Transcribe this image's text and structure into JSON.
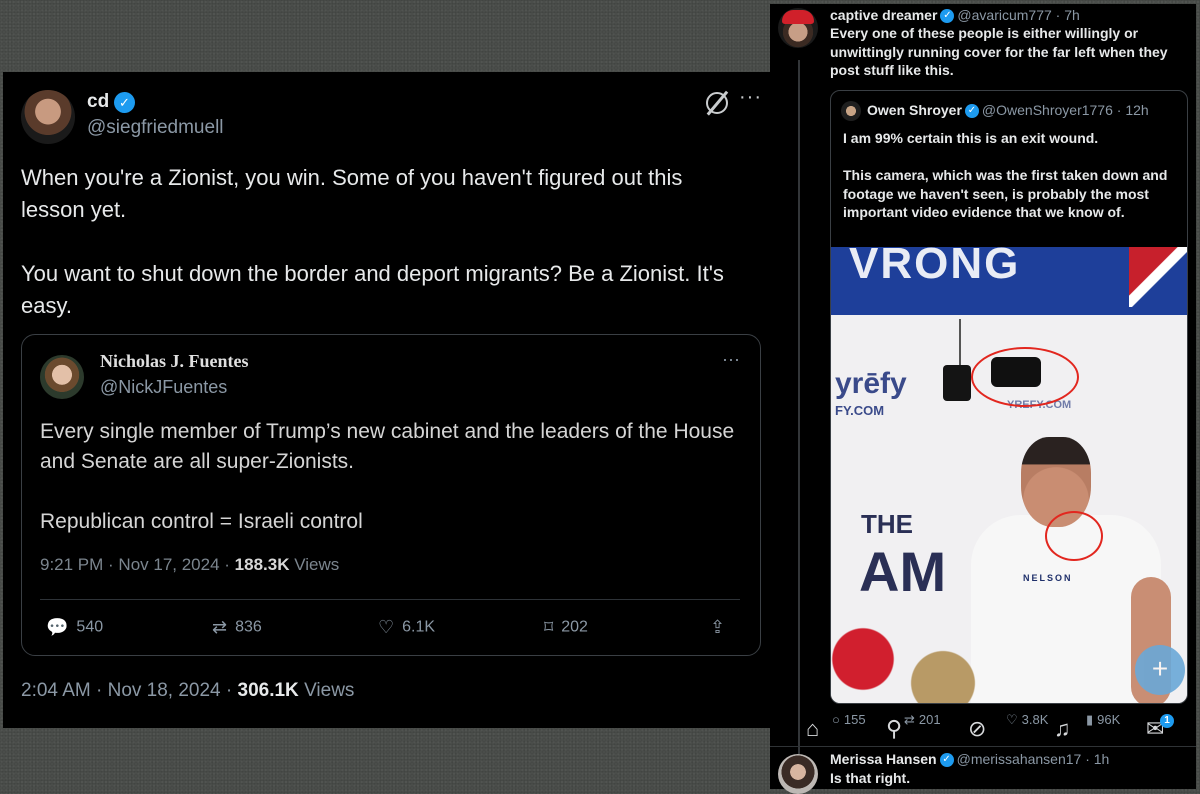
{
  "left_post": {
    "author_name": "cd",
    "author_handle": "@siegfriedmuell",
    "more": "···",
    "text": "When you're a Zionist, you win.  Some of you haven't figured out this lesson yet.\n\nYou want to shut down the border and deport migrants?  Be a Zionist.  It's easy.",
    "time": "2:04 AM · Nov 18, 2024 · ",
    "views_count": "306.1K",
    "views_label": " Views",
    "quote": {
      "author_name": "Nicholas J. Fuentes",
      "author_handle": "@NickJFuentes",
      "more": "···",
      "text": "Every single member of Trump’s new cabinet and the leaders of the House and Senate are all super-Zionists.\n\nRepublican control = Israeli control",
      "time": "9:21 PM · Nov 17, 2024 · ",
      "views_count": "188.3K",
      "views_label": " Views",
      "replies": "540",
      "reposts": "836",
      "likes": "6.1K",
      "bookmarks": "202"
    }
  },
  "right_thread": {
    "reply1": {
      "author_name": "captive dreamer",
      "author_handle": "@avaricum777 · 7h",
      "text": "Every one of these people is either willingly or unwittingly running cover for the far left when they post stuff like this."
    },
    "quote": {
      "author_name": "Owen Shroyer",
      "author_handle": "@OwenShroyer1776 · 12h",
      "text": "I am 99% certain this is an exit wound.\n\nThis camera, which was the first taken down and footage we haven't seen, is probably the most important video evidence that we know of.",
      "video": {
        "banner_text": "VRONG",
        "brand_left": "yrēfy",
        "brand_left_url": "FY.COM",
        "brand_right": "YREFY.COM",
        "backdrop_word": "THE",
        "backdrop_word2": "AM",
        "shirt_text": "NELSON"
      }
    },
    "actions": {
      "replies": "155",
      "reposts": "201",
      "likes": "3.8K",
      "views": "96K"
    },
    "nav_badge": "1",
    "reply2": {
      "author_name": "Merissa Hansen",
      "author_handle": "@merissahansen17 · 1h",
      "text": "Is that right."
    }
  },
  "colors": {
    "accent": "#1d9bf0",
    "background": "#000000",
    "annotation_red": "#e2271f"
  }
}
